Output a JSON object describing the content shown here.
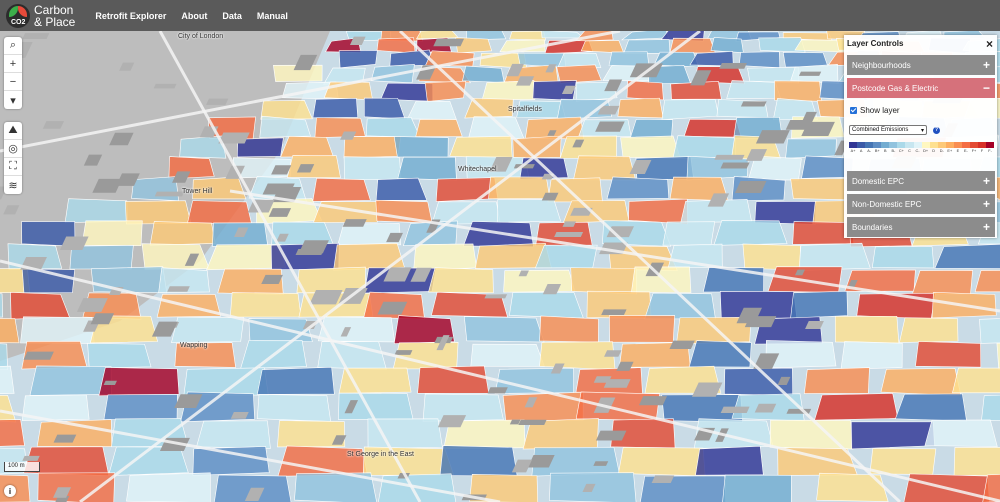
{
  "brand": {
    "line1": "Carbon",
    "line2": "& Place",
    "badge": "CO2"
  },
  "nav": [
    "Retrofit Explorer",
    "About",
    "Data",
    "Manual"
  ],
  "map": {
    "labels": {
      "city_of_london": "City of London",
      "spitalfields": "Spitalfields",
      "whitechapel": "Whitechapel",
      "tower_hill": "Tower Hill",
      "wapping": "Wapping",
      "st_george": "St George in the East"
    },
    "scale": "100 m",
    "info": "i"
  },
  "left_controls": {
    "top": [
      {
        "icon": "search-icon",
        "glyph": "⌕"
      },
      {
        "icon": "zoom-in-icon",
        "glyph": "+"
      },
      {
        "icon": "zoom-out-icon",
        "glyph": "−"
      },
      {
        "icon": "compass-icon",
        "glyph": "▾"
      }
    ],
    "tools": [
      {
        "icon": "terrain-icon",
        "glyph": "⛰"
      },
      {
        "icon": "locate-icon",
        "glyph": "◎"
      },
      {
        "icon": "fullscreen-icon",
        "glyph": "⛶"
      },
      {
        "icon": "layers-icon",
        "glyph": "≋"
      }
    ]
  },
  "panel": {
    "title": "Layer Controls",
    "close": "×",
    "sections": [
      {
        "label": "Neighbourhoods",
        "toggle": "+",
        "active": false
      },
      {
        "label": "Postcode Gas & Electric",
        "toggle": "−",
        "active": true
      },
      {
        "label": "Domestic EPC",
        "toggle": "+",
        "active": false
      },
      {
        "label": "Non-Domestic EPC",
        "toggle": "+",
        "active": false
      },
      {
        "label": "Boundaries",
        "toggle": "+",
        "active": false
      }
    ],
    "show_layer": "Show layer",
    "select_value": "Combined Emissions",
    "select_arrow": "▾",
    "help": "?",
    "legend": {
      "labels": [
        "A+",
        "A",
        "A-",
        "B+",
        "B",
        "B-",
        "C+",
        "C",
        "C-",
        "D+",
        "D",
        "D-",
        "E+",
        "E",
        "E-",
        "F+",
        "F",
        "F-"
      ],
      "colors": [
        "#313695",
        "#3b5aa8",
        "#4575b4",
        "#5e8ec4",
        "#74add1",
        "#92c3de",
        "#abd9e9",
        "#c7e6f0",
        "#e0f3f8",
        "#fff7c0",
        "#fee090",
        "#fdc978",
        "#fdae61",
        "#f98e52",
        "#f46d43",
        "#e34a33",
        "#d73027",
        "#a50026"
      ]
    }
  }
}
